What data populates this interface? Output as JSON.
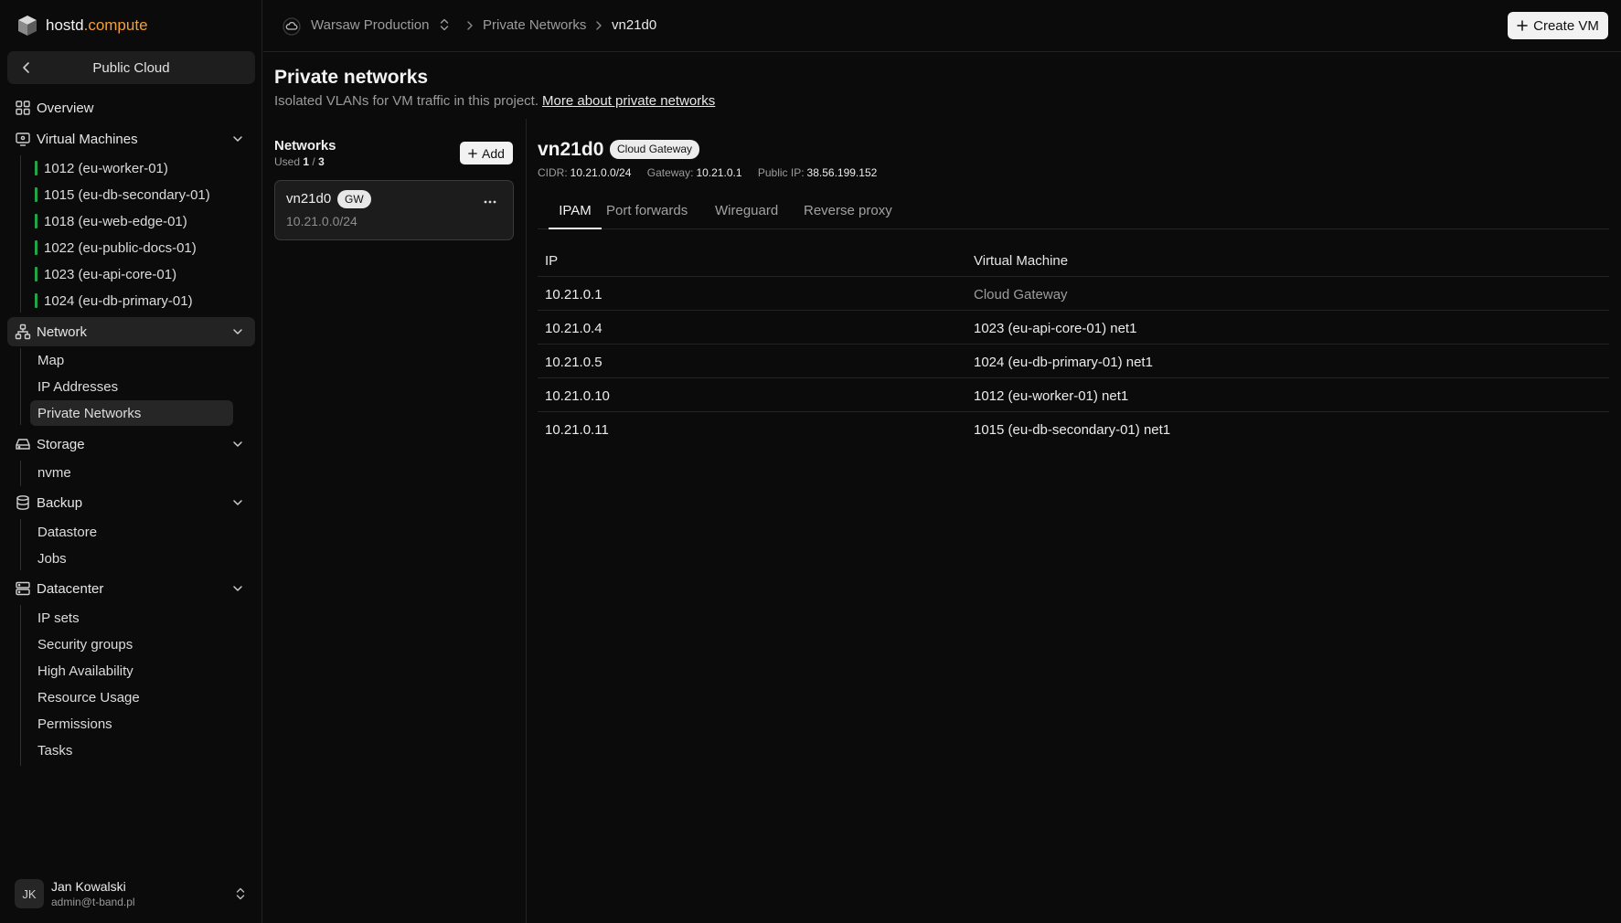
{
  "brand": {
    "name": "hostd",
    "accent": ".compute"
  },
  "sidebar": {
    "context": "Public Cloud",
    "overview": "Overview",
    "virtual_machines": {
      "label": "Virtual Machines",
      "items": [
        "1012 (eu-worker-01)",
        "1015 (eu-db-secondary-01)",
        "1018 (eu-web-edge-01)",
        "1022 (eu-public-docs-01)",
        "1023 (eu-api-core-01)",
        "1024 (eu-db-primary-01)"
      ]
    },
    "network": {
      "label": "Network",
      "items": [
        "Map",
        "IP Addresses",
        "Private Networks"
      ]
    },
    "storage": {
      "label": "Storage",
      "items": [
        "nvme"
      ]
    },
    "backup": {
      "label": "Backup",
      "items": [
        "Datastore",
        "Jobs"
      ]
    },
    "datacenter": {
      "label": "Datacenter",
      "items": [
        "IP sets",
        "Security groups",
        "High Availability",
        "Resource Usage",
        "Permissions",
        "Tasks"
      ]
    },
    "user": {
      "initials": "JK",
      "name": "Jan Kowalski",
      "email": "admin@t-band.pl"
    }
  },
  "topbar": {
    "project": "Warsaw Production",
    "breadcrumb": [
      "Private Networks",
      "vn21d0"
    ],
    "create_vm": "Create VM"
  },
  "page": {
    "title": "Private networks",
    "subtitle": "Isolated VLANs for VM traffic in this project.",
    "link": "More about private networks"
  },
  "networks": {
    "title": "Networks",
    "used_label": "Used",
    "used": "1",
    "total": "3",
    "add": "Add",
    "items": [
      {
        "name": "vn21d0",
        "badge": "GW",
        "cidr": "10.21.0.0/24"
      }
    ]
  },
  "detail": {
    "name": "vn21d0",
    "badge": "Cloud Gateway",
    "cidr_label": "CIDR:",
    "cidr": "10.21.0.0/24",
    "gateway_label": "Gateway:",
    "gateway": "10.21.0.1",
    "public_ip_label": "Public IP:",
    "public_ip": "38.56.199.152",
    "tabs": [
      "IPAM",
      "Port forwards",
      "Wireguard",
      "Reverse proxy"
    ],
    "active_tab": "IPAM",
    "table": {
      "headers": [
        "IP",
        "Virtual Machine"
      ],
      "rows": [
        {
          "ip": "10.21.0.1",
          "vm": "Cloud Gateway"
        },
        {
          "ip": "10.21.0.4",
          "vm": "1023 (eu-api-core-01) net1"
        },
        {
          "ip": "10.21.0.5",
          "vm": "1024 (eu-db-primary-01) net1"
        },
        {
          "ip": "10.21.0.10",
          "vm": "1012 (eu-worker-01) net1"
        },
        {
          "ip": "10.21.0.11",
          "vm": "1015 (eu-db-secondary-01) net1"
        }
      ]
    }
  },
  "colors": {
    "background": "#0b0b0b",
    "accent": "#f0a13a",
    "vm_status": "#22a447"
  }
}
